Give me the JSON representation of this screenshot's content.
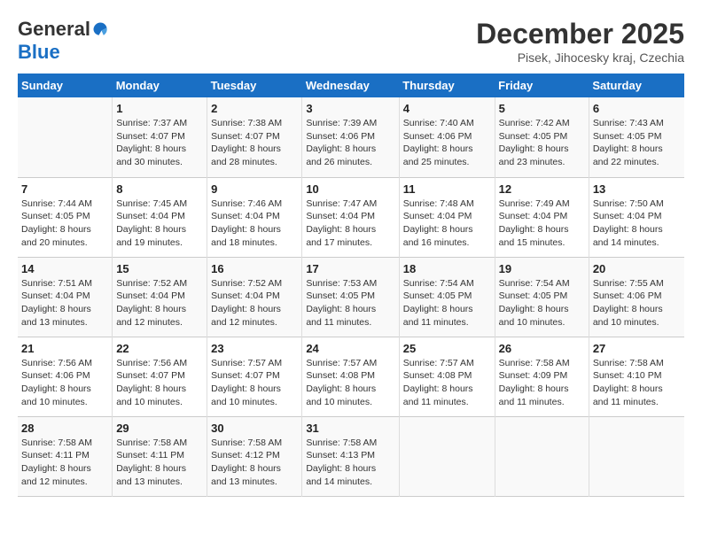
{
  "logo": {
    "general": "General",
    "blue": "Blue"
  },
  "title": "December 2025",
  "subtitle": "Pisek, Jihocesky kraj, Czechia",
  "days_header": [
    "Sunday",
    "Monday",
    "Tuesday",
    "Wednesday",
    "Thursday",
    "Friday",
    "Saturday"
  ],
  "weeks": [
    [
      {
        "num": "",
        "info": ""
      },
      {
        "num": "1",
        "info": "Sunrise: 7:37 AM\nSunset: 4:07 PM\nDaylight: 8 hours\nand 30 minutes."
      },
      {
        "num": "2",
        "info": "Sunrise: 7:38 AM\nSunset: 4:07 PM\nDaylight: 8 hours\nand 28 minutes."
      },
      {
        "num": "3",
        "info": "Sunrise: 7:39 AM\nSunset: 4:06 PM\nDaylight: 8 hours\nand 26 minutes."
      },
      {
        "num": "4",
        "info": "Sunrise: 7:40 AM\nSunset: 4:06 PM\nDaylight: 8 hours\nand 25 minutes."
      },
      {
        "num": "5",
        "info": "Sunrise: 7:42 AM\nSunset: 4:05 PM\nDaylight: 8 hours\nand 23 minutes."
      },
      {
        "num": "6",
        "info": "Sunrise: 7:43 AM\nSunset: 4:05 PM\nDaylight: 8 hours\nand 22 minutes."
      }
    ],
    [
      {
        "num": "7",
        "info": "Sunrise: 7:44 AM\nSunset: 4:05 PM\nDaylight: 8 hours\nand 20 minutes."
      },
      {
        "num": "8",
        "info": "Sunrise: 7:45 AM\nSunset: 4:04 PM\nDaylight: 8 hours\nand 19 minutes."
      },
      {
        "num": "9",
        "info": "Sunrise: 7:46 AM\nSunset: 4:04 PM\nDaylight: 8 hours\nand 18 minutes."
      },
      {
        "num": "10",
        "info": "Sunrise: 7:47 AM\nSunset: 4:04 PM\nDaylight: 8 hours\nand 17 minutes."
      },
      {
        "num": "11",
        "info": "Sunrise: 7:48 AM\nSunset: 4:04 PM\nDaylight: 8 hours\nand 16 minutes."
      },
      {
        "num": "12",
        "info": "Sunrise: 7:49 AM\nSunset: 4:04 PM\nDaylight: 8 hours\nand 15 minutes."
      },
      {
        "num": "13",
        "info": "Sunrise: 7:50 AM\nSunset: 4:04 PM\nDaylight: 8 hours\nand 14 minutes."
      }
    ],
    [
      {
        "num": "14",
        "info": "Sunrise: 7:51 AM\nSunset: 4:04 PM\nDaylight: 8 hours\nand 13 minutes."
      },
      {
        "num": "15",
        "info": "Sunrise: 7:52 AM\nSunset: 4:04 PM\nDaylight: 8 hours\nand 12 minutes."
      },
      {
        "num": "16",
        "info": "Sunrise: 7:52 AM\nSunset: 4:04 PM\nDaylight: 8 hours\nand 12 minutes."
      },
      {
        "num": "17",
        "info": "Sunrise: 7:53 AM\nSunset: 4:05 PM\nDaylight: 8 hours\nand 11 minutes."
      },
      {
        "num": "18",
        "info": "Sunrise: 7:54 AM\nSunset: 4:05 PM\nDaylight: 8 hours\nand 11 minutes."
      },
      {
        "num": "19",
        "info": "Sunrise: 7:54 AM\nSunset: 4:05 PM\nDaylight: 8 hours\nand 10 minutes."
      },
      {
        "num": "20",
        "info": "Sunrise: 7:55 AM\nSunset: 4:06 PM\nDaylight: 8 hours\nand 10 minutes."
      }
    ],
    [
      {
        "num": "21",
        "info": "Sunrise: 7:56 AM\nSunset: 4:06 PM\nDaylight: 8 hours\nand 10 minutes."
      },
      {
        "num": "22",
        "info": "Sunrise: 7:56 AM\nSunset: 4:07 PM\nDaylight: 8 hours\nand 10 minutes."
      },
      {
        "num": "23",
        "info": "Sunrise: 7:57 AM\nSunset: 4:07 PM\nDaylight: 8 hours\nand 10 minutes."
      },
      {
        "num": "24",
        "info": "Sunrise: 7:57 AM\nSunset: 4:08 PM\nDaylight: 8 hours\nand 10 minutes."
      },
      {
        "num": "25",
        "info": "Sunrise: 7:57 AM\nSunset: 4:08 PM\nDaylight: 8 hours\nand 11 minutes."
      },
      {
        "num": "26",
        "info": "Sunrise: 7:58 AM\nSunset: 4:09 PM\nDaylight: 8 hours\nand 11 minutes."
      },
      {
        "num": "27",
        "info": "Sunrise: 7:58 AM\nSunset: 4:10 PM\nDaylight: 8 hours\nand 11 minutes."
      }
    ],
    [
      {
        "num": "28",
        "info": "Sunrise: 7:58 AM\nSunset: 4:11 PM\nDaylight: 8 hours\nand 12 minutes."
      },
      {
        "num": "29",
        "info": "Sunrise: 7:58 AM\nSunset: 4:11 PM\nDaylight: 8 hours\nand 13 minutes."
      },
      {
        "num": "30",
        "info": "Sunrise: 7:58 AM\nSunset: 4:12 PM\nDaylight: 8 hours\nand 13 minutes."
      },
      {
        "num": "31",
        "info": "Sunrise: 7:58 AM\nSunset: 4:13 PM\nDaylight: 8 hours\nand 14 minutes."
      },
      {
        "num": "",
        "info": ""
      },
      {
        "num": "",
        "info": ""
      },
      {
        "num": "",
        "info": ""
      }
    ]
  ]
}
